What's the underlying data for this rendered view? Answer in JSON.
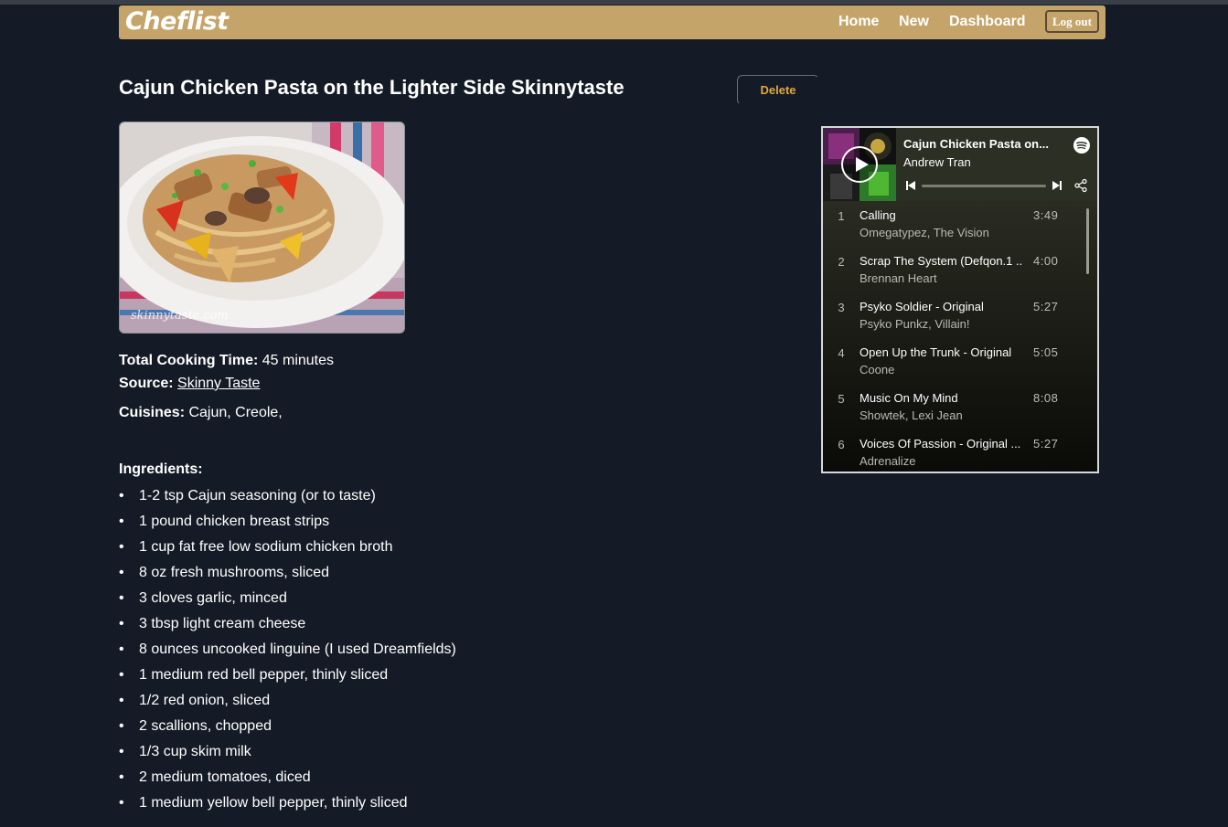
{
  "navbar": {
    "brand": "Cheflist",
    "links": [
      "Home",
      "New",
      "Dashboard"
    ],
    "logout_label": "Log out",
    "color": "#c5a46a"
  },
  "recipe": {
    "title": "Cajun Chicken Pasta on the Lighter Side Skinnytaste",
    "delete_label": "Delete",
    "image_watermark": "skinnytaste.com",
    "cooking_time_label": "Total Cooking Time:",
    "cooking_time_value": "45 minutes",
    "source_label": "Source:",
    "source_link": "Skinny Taste",
    "cuisines_label": "Cuisines:",
    "cuisines_value": "Cajun, Creole,",
    "ingredients_heading": "Ingredients:",
    "ingredients": [
      "1-2 tsp Cajun seasoning (or to taste)",
      "1 pound chicken breast strips",
      "1 cup fat free low sodium chicken broth",
      "8 oz fresh mushrooms, sliced",
      "3 cloves garlic, minced",
      "3 tbsp light cream cheese",
      "8 ounces uncooked linguine (I used Dreamfields)",
      "1 medium red bell pepper, thinly sliced",
      "1/2 red onion, sliced",
      "2 scallions, chopped",
      "1/3 cup skim milk",
      "2 medium tomatoes, diced",
      "1 medium yellow bell pepper, thinly sliced"
    ]
  },
  "player": {
    "playlist_title": "Cajun Chicken Pasta on...",
    "owner": "Andrew Tran",
    "icons": [
      "spotify-icon",
      "previous-icon",
      "next-icon",
      "share-icon",
      "play-icon"
    ],
    "tracks": [
      {
        "num": "1",
        "name": "Calling",
        "artists": "Omegatypez, The Vision",
        "duration": "3:49"
      },
      {
        "num": "2",
        "name": "Scrap The System (Defqon.1 ...",
        "artists": "Brennan Heart",
        "duration": "4:00"
      },
      {
        "num": "3",
        "name": "Psyko Soldier - Original",
        "artists": "Psyko Punkz, Villain!",
        "duration": "5:27"
      },
      {
        "num": "4",
        "name": "Open Up the Trunk - Original",
        "artists": "Coone",
        "duration": "5:05"
      },
      {
        "num": "5",
        "name": "Music On My Mind",
        "artists": "Showtek, Lexi Jean",
        "duration": "8:08"
      },
      {
        "num": "6",
        "name": "Voices Of Passion - Original ...",
        "artists": "Adrenalize",
        "duration": "5:27"
      }
    ]
  }
}
